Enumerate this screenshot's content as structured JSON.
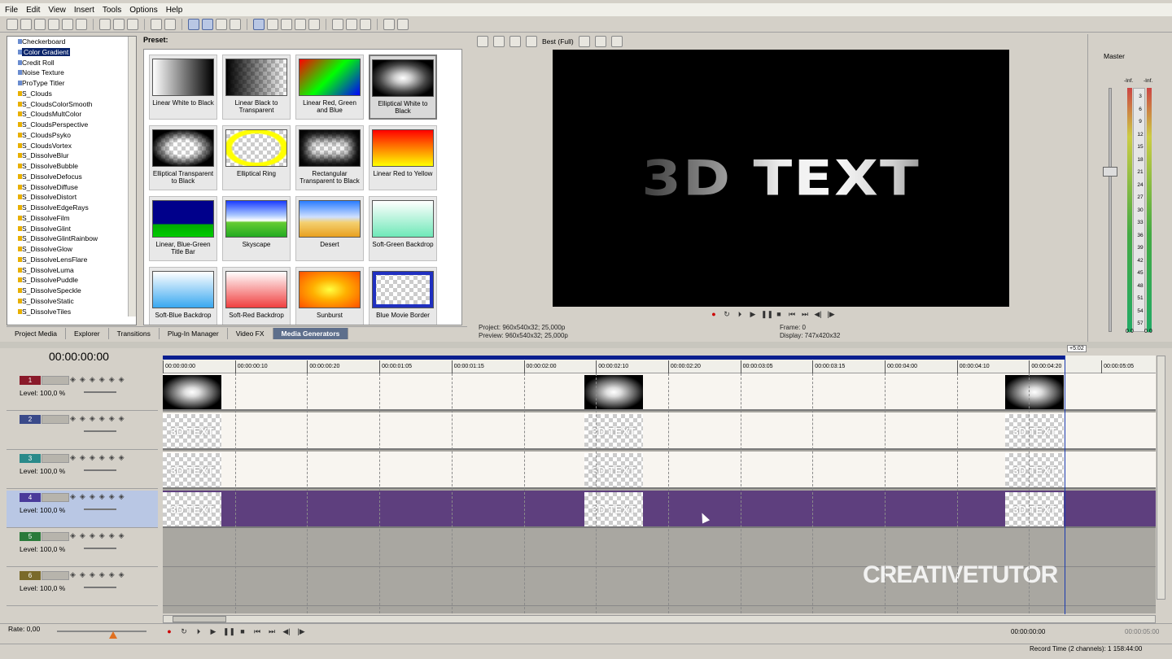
{
  "menu": [
    "File",
    "Edit",
    "View",
    "Insert",
    "Tools",
    "Options",
    "Help"
  ],
  "generators": [
    "Checkerboard",
    "Color Gradient",
    "Credit Roll",
    "Noise Texture",
    "ProType Titler",
    "S_Clouds",
    "S_CloudsColorSmooth",
    "S_CloudsMultColor",
    "S_CloudsPerspective",
    "S_CloudsPsyko",
    "S_CloudsVortex",
    "S_DissolveBlur",
    "S_DissolveBubble",
    "S_DissolveDefocus",
    "S_DissolveDiffuse",
    "S_DissolveDistort",
    "S_DissolveEdgeRays",
    "S_DissolveFilm",
    "S_DissolveGlint",
    "S_DissolveGlintRainbow",
    "S_DissolveGlow",
    "S_DissolveLensFlare",
    "S_DissolveLuma",
    "S_DissolvePuddle",
    "S_DissolveSpeckle",
    "S_DissolveStatic",
    "S_DissolveTiles"
  ],
  "selected_generator": "Color Gradient",
  "preset_label": "Preset:",
  "presets": [
    {
      "label": "Linear White to Black",
      "style": "lwb"
    },
    {
      "label": "Linear Black to Transparent",
      "style": "lbt"
    },
    {
      "label": "Linear Red, Green and Blue",
      "style": "rgb"
    },
    {
      "label": "Elliptical White to Black",
      "style": "ewb"
    },
    {
      "label": "Elliptical Transparent to Black",
      "style": "etb"
    },
    {
      "label": "Elliptical Ring",
      "style": "ring"
    },
    {
      "label": "Rectangular Transparent to Black",
      "style": "rtb"
    },
    {
      "label": "Linear Red to Yellow",
      "style": "rty"
    },
    {
      "label": "Linear, Blue-Green Title Bar",
      "style": "bgt"
    },
    {
      "label": "Skyscape",
      "style": "sky"
    },
    {
      "label": "Desert",
      "style": "des"
    },
    {
      "label": "Soft-Green Backdrop",
      "style": "sgb"
    },
    {
      "label": "Soft-Blue Backdrop",
      "style": "sbb"
    },
    {
      "label": "Soft-Red Backdrop",
      "style": "srb"
    },
    {
      "label": "Sunburst",
      "style": "sun"
    },
    {
      "label": "Blue Movie Border",
      "style": "bmb"
    }
  ],
  "tabs": [
    "Project Media",
    "Explorer",
    "Transitions",
    "Plug-In Manager",
    "Video FX",
    "Media Generators"
  ],
  "active_tab": "Media Generators",
  "preview": {
    "quality": "Best (Full)",
    "text": "3D TEXT",
    "project": "Project:   960x540x32; 25,000p",
    "preview": "Preview:   960x540x32; 25,000p",
    "frame": "Frame:     0",
    "display": "Display:   747x420x32"
  },
  "mixer": {
    "title": "Master",
    "inf_left": "-Inf.",
    "inf_right": "-Inf.",
    "scale": [
      "3",
      "6",
      "9",
      "12",
      "15",
      "18",
      "21",
      "24",
      "27",
      "30",
      "33",
      "36",
      "39",
      "42",
      "45",
      "48",
      "51",
      "54",
      "57"
    ],
    "bottom_left": "0.0",
    "bottom_right": "0.0"
  },
  "timeline": {
    "timecode": "00:00:00:00",
    "ruler": [
      "00:00:00:00",
      "00:00:00:10",
      "00:00:00:20",
      "00:00:01:05",
      "00:00:01:15",
      "00:00:02:00",
      "00:00:02:10",
      "00:00:02:20",
      "00:00:03:05",
      "00:00:03:15",
      "00:00:04:00",
      "00:00:04:10",
      "00:00:04:20",
      "00:00:05:05"
    ],
    "region": "+5:02",
    "clip_text": "3D TEXT",
    "tracks": [
      {
        "num": "1",
        "color": "#8a1a2a",
        "level": "Level: 100,0 %"
      },
      {
        "num": "2",
        "color": "#3a4a8a",
        "level": ""
      },
      {
        "num": "3",
        "color": "#2a8a8a",
        "level": "Level: 100,0 %"
      },
      {
        "num": "4",
        "color": "#4a3a9a",
        "level": "Level: 100,0 %"
      },
      {
        "num": "5",
        "color": "#2a7a3a",
        "level": "Level: 100,0 %"
      },
      {
        "num": "6",
        "color": "#7a6a2a",
        "level": "Level: 100,0 %"
      }
    ]
  },
  "bottom": {
    "rate": "Rate: 0,00",
    "timecode_left": "00:00:00:00",
    "timecode_right": "00:00:05:00",
    "record_time": "Record Time (2 channels): 1 158:44:00"
  },
  "watermark": "CREATIVETUTOR"
}
